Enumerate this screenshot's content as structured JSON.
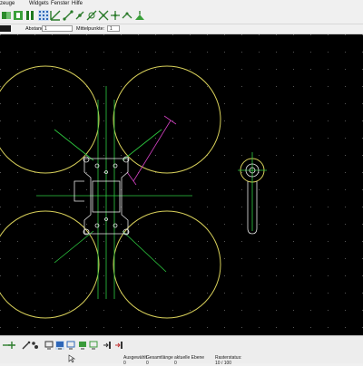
{
  "menu": {
    "items": [
      "zeuge",
      "Widgets",
      "Fenster",
      "Hilfe"
    ]
  },
  "toolbar": {
    "tools": [
      "snap-grid-icon",
      "snap-endpoint-icon",
      "snap-middle-icon",
      "snap-center-icon",
      "snap-intersection-icon",
      "snap-reference-icon",
      "snap-free-icon",
      "snap-crosshair-icon",
      "restrict-nothing-icon",
      "restrict-orthogonal-icon",
      "restrict-horizontal-icon",
      "restrict-vertical-icon",
      "relative-zero-icon",
      "lock-relative-zero-icon"
    ]
  },
  "options": {
    "distance_label": "Abstand:",
    "distance_value": "1",
    "midpoints_label": "Mittelpunkte:",
    "midpoints_value": "1"
  },
  "statusbar": {
    "selected_label": "Ausgewählt",
    "total_length_label": "Gesamtlänge",
    "current_layer_label": "aktuelle Ebene",
    "grid_status_label": "Rasterstatus:",
    "grid_status_value": "10 / 100",
    "selected_value": "0",
    "total_length_value": "0",
    "current_layer_value": "0"
  },
  "colors": {
    "canvas": "#000000",
    "frame_lines": "#e8e8e8",
    "propeller": "#d8d05a",
    "arms": "#2ecc40",
    "dimension": "#d040c0",
    "grid_dots": "#5a5a5a"
  }
}
